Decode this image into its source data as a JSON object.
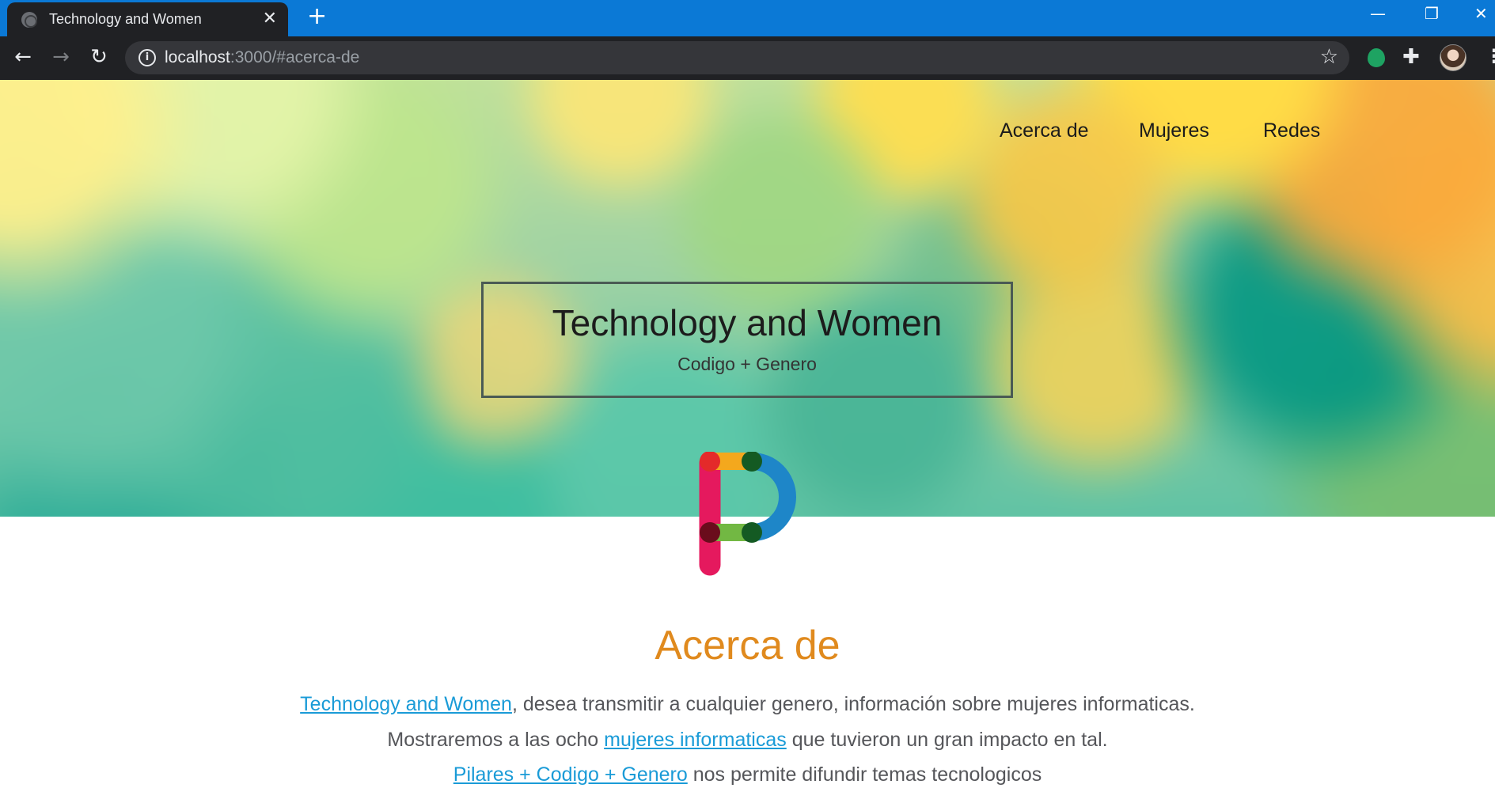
{
  "browser": {
    "tab_title": "Technology and Women",
    "tab_close": "✕",
    "new_tab": "+",
    "url_host": "localhost",
    "url_rest": ":3000/#acerca-de",
    "window_controls": {
      "minimize": "—",
      "restore": "❐",
      "close": "✕"
    },
    "nav_icons": {
      "back": "←",
      "forward": "→",
      "reload": "↻"
    },
    "info_icon": "i",
    "star_icon": "☆",
    "extension_icon": "✚",
    "menu_icon": "⋮"
  },
  "site_nav": {
    "items": [
      {
        "label": "Acerca de"
      },
      {
        "label": "Mujeres"
      },
      {
        "label": "Redes"
      }
    ]
  },
  "hero": {
    "title": "Technology and Women",
    "subtitle": "Codigo + Genero"
  },
  "about": {
    "heading": "Acerca de",
    "line1_link": "Technology and Women",
    "line1_rest": ", desea transmitir a cualquier genero, información sobre mujeres informaticas.",
    "line2_pre": "Mostraremos a las ocho ",
    "line2_link": "mujeres informaticas",
    "line2_post": " que tuvieron un gran impacto en tal.",
    "line3_link": "Pilares + Codigo + Genero",
    "line3_rest": " nos permite difundir temas tecnologicos"
  },
  "colors": {
    "heading_orange": "#e08a1e",
    "link_blue": "#1a9bd7",
    "body_text": "#55565a",
    "chrome_blue": "#0b79d6",
    "chrome_dark": "#202124"
  }
}
